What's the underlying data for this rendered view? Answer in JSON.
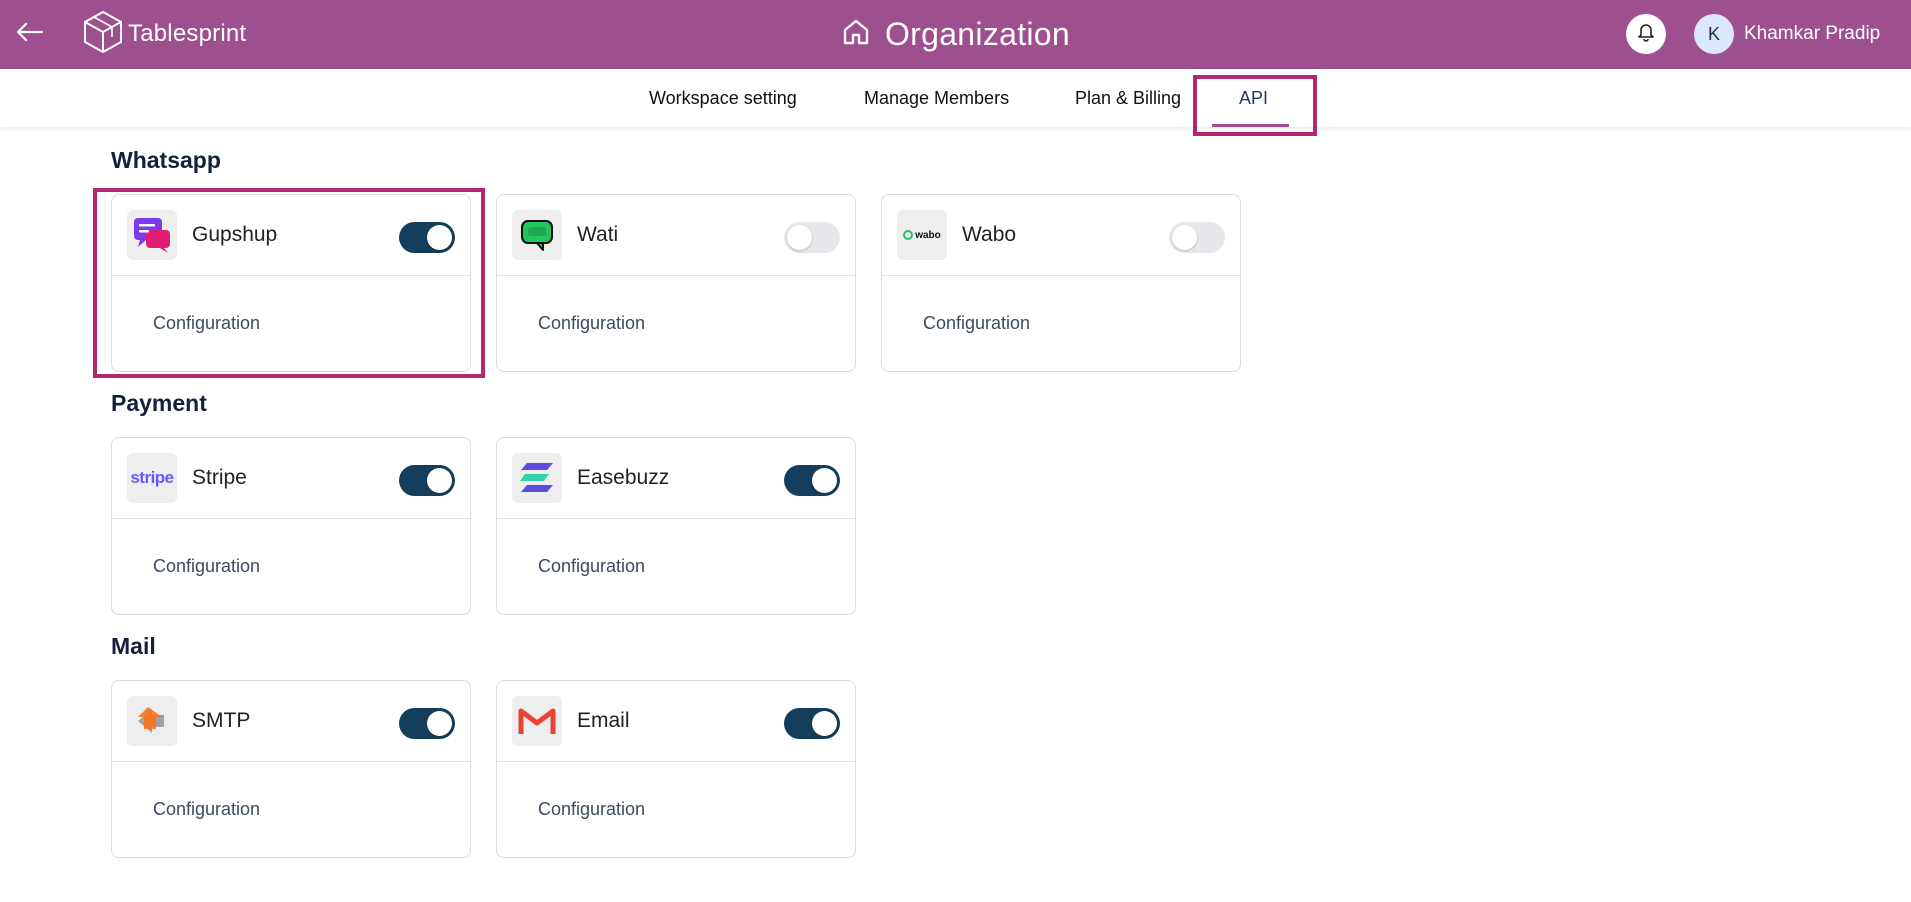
{
  "header": {
    "brand": "Tablesprint",
    "title": "Organization",
    "user": {
      "initial": "K",
      "name": "Khamkar Pradip"
    }
  },
  "tabs": [
    {
      "label": "Workspace setting"
    },
    {
      "label": "Manage Members"
    },
    {
      "label": "Plan & Billing"
    },
    {
      "label": "API",
      "active": true
    }
  ],
  "sections": {
    "whatsapp": {
      "title": "Whatsapp",
      "cards": [
        {
          "name": "Gupshup",
          "enabled": true,
          "config": "Configuration"
        },
        {
          "name": "Wati",
          "enabled": false,
          "config": "Configuration"
        },
        {
          "name": "Wabo",
          "enabled": false,
          "config": "Configuration",
          "logo_text": "wabo"
        }
      ]
    },
    "payment": {
      "title": "Payment",
      "cards": [
        {
          "name": "Stripe",
          "enabled": true,
          "config": "Configuration",
          "logo_text": "stripe"
        },
        {
          "name": "Easebuzz",
          "enabled": true,
          "config": "Configuration"
        }
      ]
    },
    "mail": {
      "title": "Mail",
      "cards": [
        {
          "name": "SMTP",
          "enabled": true,
          "config": "Configuration"
        },
        {
          "name": "Email",
          "enabled": true,
          "config": "Configuration"
        }
      ]
    }
  },
  "colors": {
    "header_bg": "#9e4f90",
    "toggle_on": "#153e5c",
    "toggle_off": "#e5e7eb",
    "highlight": "#b3276f"
  }
}
